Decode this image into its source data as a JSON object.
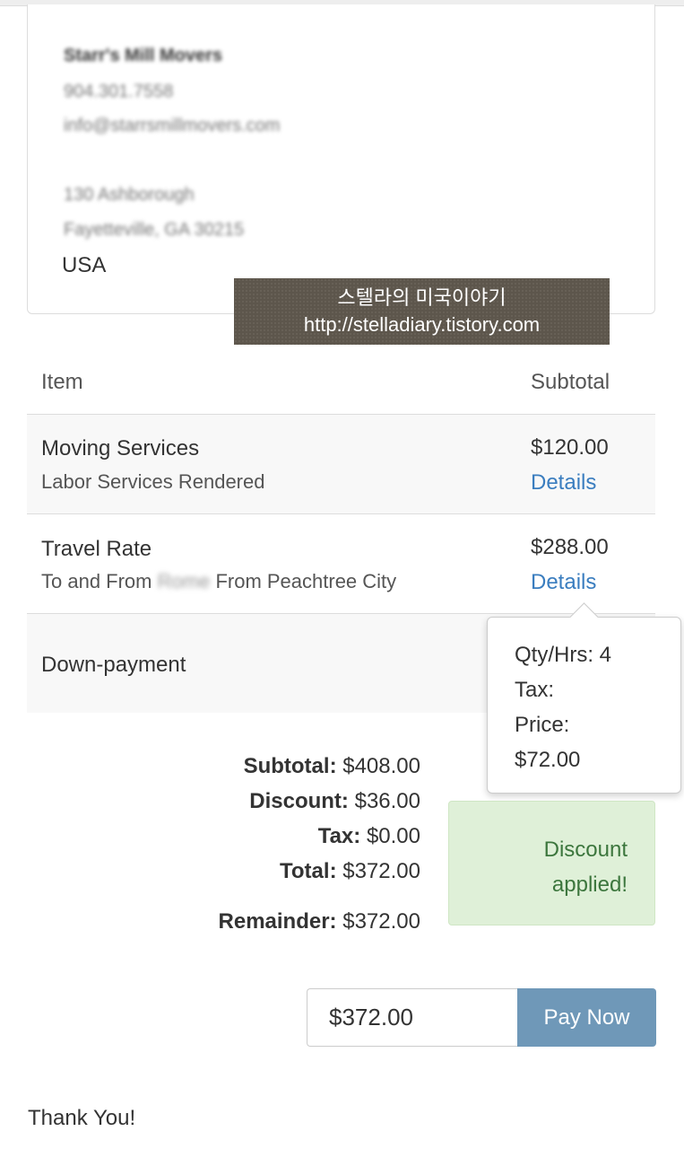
{
  "company": {
    "name": "Starr's Mill Movers",
    "phone": "904.301.7558",
    "email": "info@starrsmillmovers.com",
    "address_line1": "130 Ashborough",
    "address_line2": "Fayetteville, GA 30215",
    "country": "USA"
  },
  "watermark": {
    "line1": "스텔라의 미국이야기",
    "line2": "http://stelladiary.tistory.com"
  },
  "table": {
    "col_item": "Item",
    "col_subtotal": "Subtotal",
    "rows": [
      {
        "title": "Moving Services",
        "subtitle": "Labor Services Rendered",
        "amount": "$120.00",
        "link": "Details"
      },
      {
        "title": "Travel Rate",
        "subtitle_prefix": "To and From",
        "subtitle_hidden": "Rome",
        "subtitle_suffix": "From Peachtree City",
        "amount": "$288.00",
        "link": "Details"
      },
      {
        "title": "Down-payment"
      }
    ]
  },
  "popover": {
    "qty": "Qty/Hrs: 4",
    "tax": "Tax:",
    "price_label": "Price:",
    "price_value": "$72.00"
  },
  "totals": {
    "subtotal_label": "Subtotal:",
    "subtotal_value": "$408.00",
    "discount_label": "Discount:",
    "discount_value": "$36.00",
    "tax_label": "Tax:",
    "tax_value": "$0.00",
    "total_label": "Total:",
    "total_value": "$372.00",
    "remainder_label": "Remainder:",
    "remainder_value": "$372.00"
  },
  "alert": {
    "line1": "Discount",
    "line2": "applied!"
  },
  "payment": {
    "amount": "$372.00",
    "button_label": "Pay Now"
  },
  "footer": {
    "thanks": "Thank You!"
  },
  "colors": {
    "link": "#3a7dbf",
    "button": "#6f98b8",
    "alert_bg": "#dff0d8",
    "alert_text": "#3c763d"
  }
}
